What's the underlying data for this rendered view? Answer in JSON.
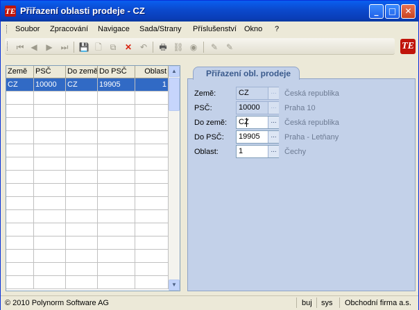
{
  "window": {
    "title": "Přiřazení oblasti prodeje - CZ",
    "app_logo": "TE",
    "controls": {
      "minimize": "_",
      "maximize": "□",
      "close": "✕"
    }
  },
  "menu": [
    "Soubor",
    "Zpracování",
    "Navigace",
    "Sada/Strany",
    "Příslušenství",
    "Okno",
    "?"
  ],
  "toolbar": {
    "icons": [
      "first-record-icon",
      "previous-record-icon",
      "next-record-icon",
      "last-record-icon",
      "save-icon",
      "new-icon",
      "copy-icon",
      "delete-icon",
      "undo-icon",
      "print-icon",
      "network-icon",
      "disk-icon",
      "edit-icon",
      "edit-alt-icon"
    ],
    "glyphs": {
      "first": "⏮",
      "prev": "◀",
      "next": "▶",
      "last": "⏭",
      "save": "💾",
      "new": "🗋",
      "copy": "⧉",
      "delete": "✕",
      "undo": "↶",
      "print": "🖶",
      "network": "⛓",
      "disk": "◉",
      "edit": "✎",
      "edit_alt": "✎"
    },
    "logo": "TE"
  },
  "grid": {
    "columns": [
      "Země",
      "PSČ",
      "Do země",
      "Do PSČ",
      "Oblast"
    ],
    "rows": [
      {
        "zeme": "CZ",
        "psc": "10000",
        "do_zeme": "CZ",
        "do_psc": "19905",
        "oblast": "1"
      }
    ],
    "scroll_up": "▲",
    "scroll_down": "▼"
  },
  "form": {
    "tab": "Přiřazení obl. prodeje",
    "picker_label": "...",
    "fields": [
      {
        "label": "Země:",
        "value": "CZ",
        "desc": "Česká republika"
      },
      {
        "label": "PSČ:",
        "value": "10000",
        "desc": "Praha 10"
      },
      {
        "label": "Do země:",
        "value": "CZ",
        "desc": "Česká republika"
      },
      {
        "label": "Do PSČ:",
        "value": "19905",
        "desc": "Praha - Letňany"
      },
      {
        "label": "Oblast:",
        "value": "1",
        "desc": "Čechy"
      }
    ]
  },
  "status": {
    "copyright": "© 2010 Polynorm Software AG",
    "user": "buj",
    "db": "sys",
    "company": "Obchodní firma a.s."
  },
  "colors": {
    "title_bar": "#0a5ff0",
    "selection": "#316ac5",
    "panel": "#c3d1e9",
    "delete": "#d9220f"
  }
}
